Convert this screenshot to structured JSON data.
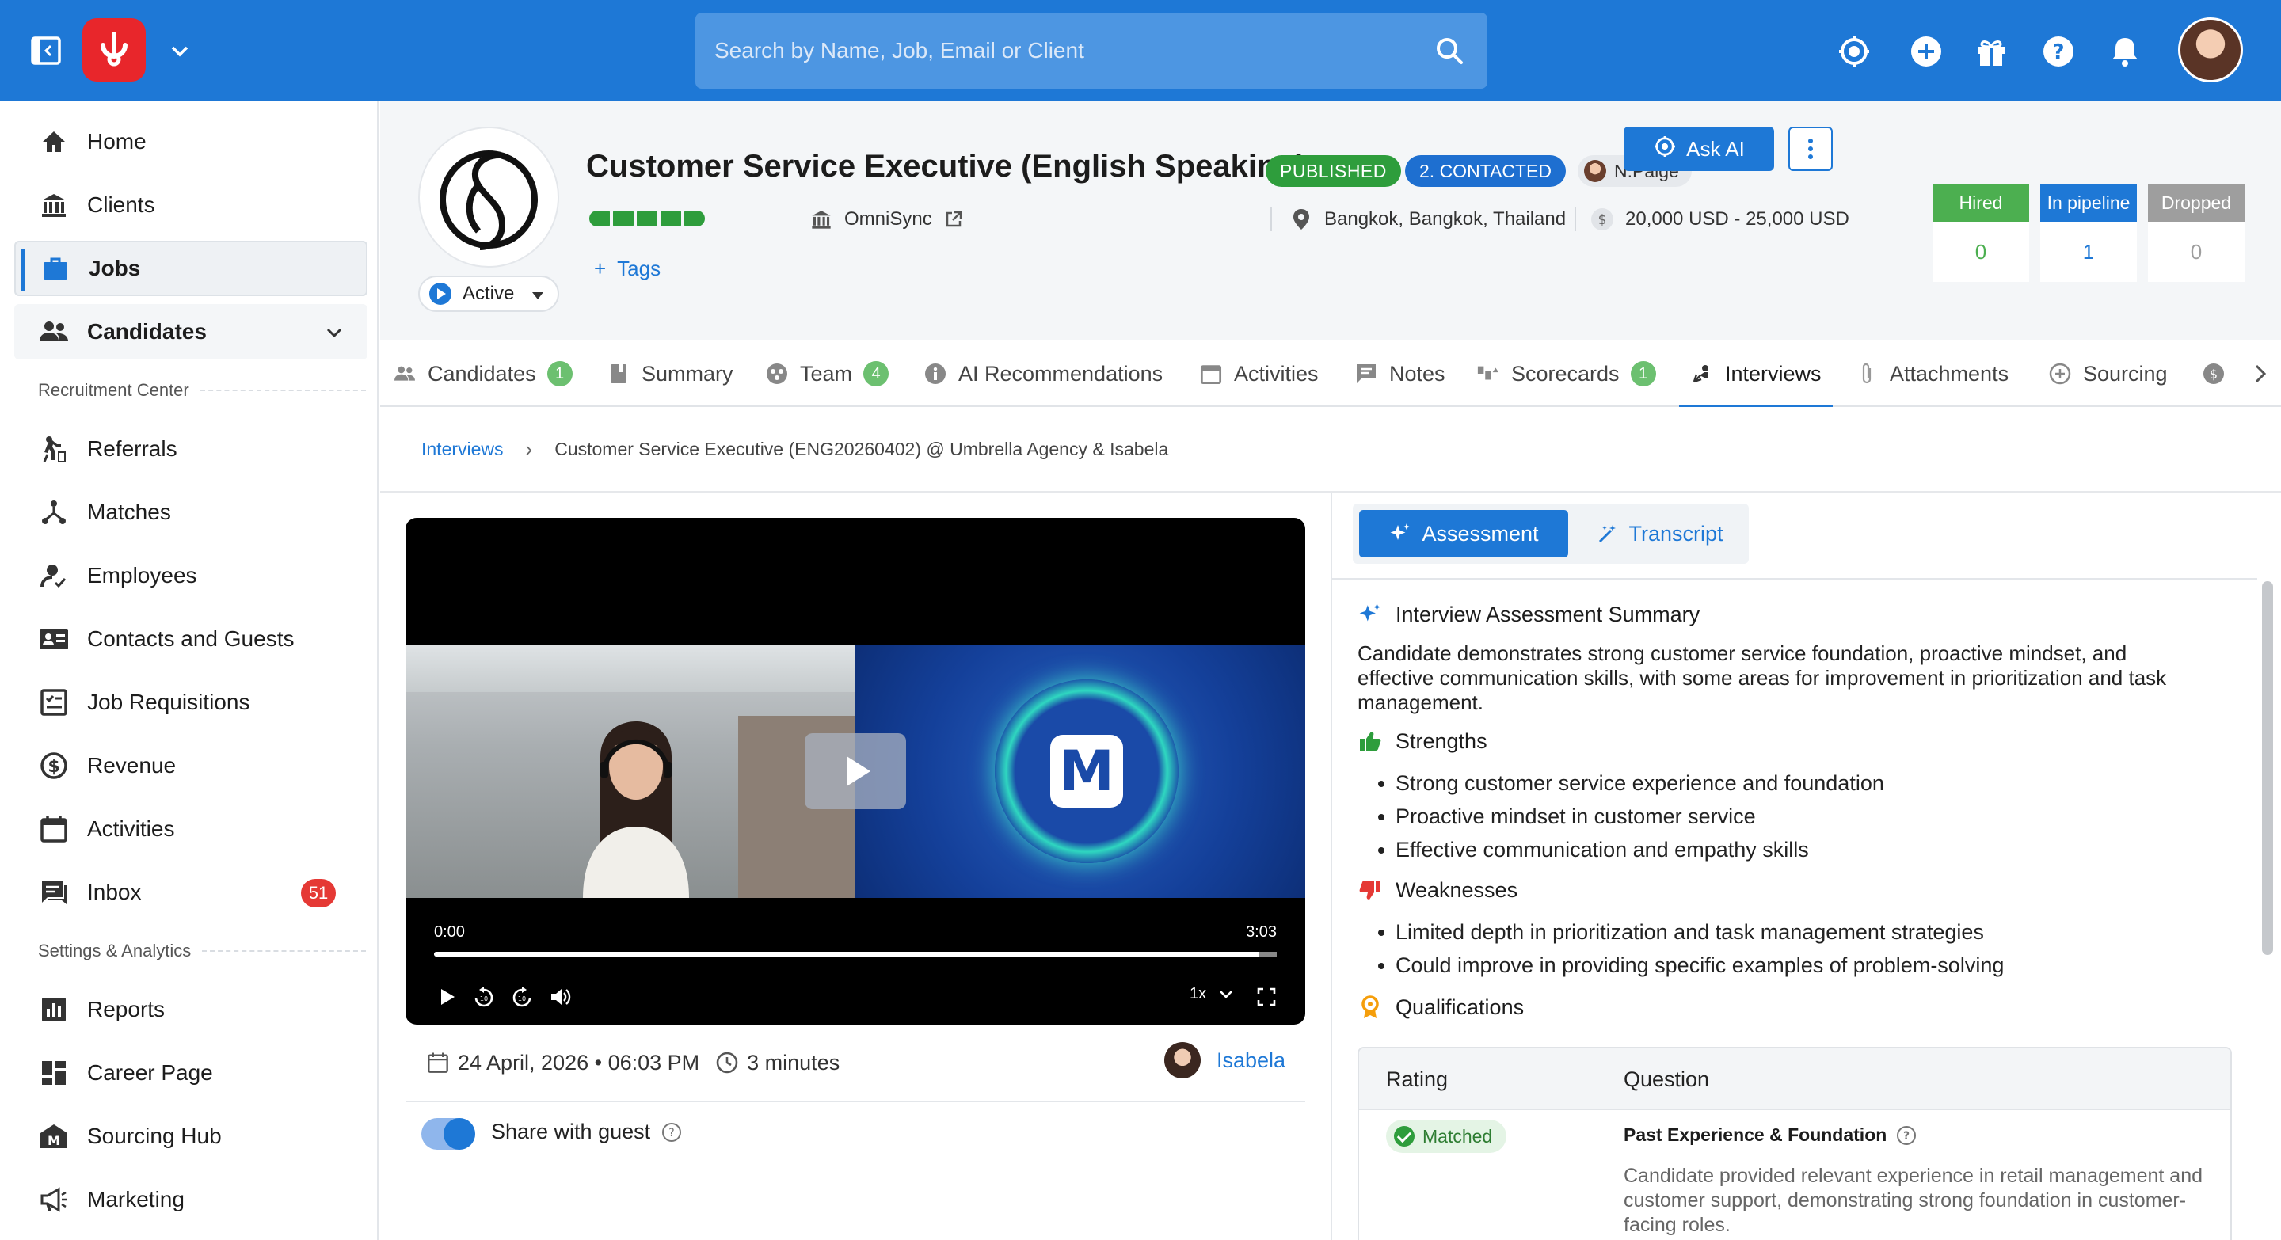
{
  "topbar": {
    "search_placeholder": "Search by Name, Job, Email or Client",
    "icons": [
      "sidebar-toggle-icon",
      "brand-logo",
      "chevron-down-icon",
      "search-icon",
      "ai-sparkle-icon",
      "plus-circle-icon",
      "gift-icon",
      "help-icon",
      "bell-icon",
      "user-avatar"
    ],
    "brand_color": "#1e78d6",
    "logo_color": "#e8262b"
  },
  "sidebar": {
    "items": [
      {
        "label": "Home",
        "icon": "home-icon"
      },
      {
        "label": "Clients",
        "icon": "building-icon"
      },
      {
        "label": "Jobs",
        "icon": "briefcase-icon",
        "active": true
      },
      {
        "label": "Candidates",
        "icon": "people-icon"
      }
    ],
    "section_recruitment": "Recruitment Center",
    "recruitment_items": [
      {
        "label": "Referrals",
        "icon": "referral-icon"
      },
      {
        "label": "Matches",
        "icon": "matches-icon"
      },
      {
        "label": "Employees",
        "icon": "employee-icon"
      },
      {
        "label": "Contacts and Guests",
        "icon": "contacts-icon"
      },
      {
        "label": "Job Requisitions",
        "icon": "requisition-icon"
      },
      {
        "label": "Revenue",
        "icon": "dollar-icon"
      },
      {
        "label": "Activities",
        "icon": "calendar-icon"
      },
      {
        "label": "Inbox",
        "icon": "inbox-icon",
        "badge": "51"
      }
    ],
    "section_settings": "Settings & Analytics",
    "settings_items": [
      {
        "label": "Reports",
        "icon": "reports-icon"
      },
      {
        "label": "Career Page",
        "icon": "career-page-icon"
      },
      {
        "label": "Sourcing Hub",
        "icon": "sourcing-hub-icon"
      },
      {
        "label": "Marketing",
        "icon": "megaphone-icon"
      }
    ]
  },
  "job": {
    "title": "Customer Service Executive (English Speaking)",
    "status_published": "PUBLISHED",
    "stage": "2. CONTACTED",
    "owner": "N.Paige",
    "company": "OmniSync",
    "location": "Bangkok, Bangkok, Thailand",
    "salary": "20,000 USD - 25,000 USD",
    "tags_label": "Tags",
    "status_select": "Active",
    "ask_ai_label": "Ask AI",
    "rating_filled": 5,
    "stats": [
      {
        "label": "Hired",
        "value": "0",
        "color": "#4caf50"
      },
      {
        "label": "In pipeline",
        "value": "1",
        "color": "#1e78d6"
      },
      {
        "label": "Dropped",
        "value": "0",
        "color": "#9e9e9e"
      }
    ]
  },
  "tabs": [
    {
      "label": "Candidates",
      "count": "1",
      "icon": "people-icon"
    },
    {
      "label": "Summary",
      "icon": "summary-icon"
    },
    {
      "label": "Team",
      "count": "4",
      "icon": "team-icon"
    },
    {
      "label": "AI Recommendations",
      "icon": "info-icon"
    },
    {
      "label": "Activities",
      "icon": "calendar-icon"
    },
    {
      "label": "Notes",
      "icon": "notes-icon"
    },
    {
      "label": "Scorecards",
      "count": "1",
      "icon": "scorecard-icon"
    },
    {
      "label": "Interviews",
      "icon": "interview-icon",
      "active": true
    },
    {
      "label": "Attachments",
      "icon": "paperclip-icon"
    },
    {
      "label": "Sourcing",
      "icon": "plus-circle-icon"
    }
  ],
  "breadcrumb": {
    "parent": "Interviews",
    "current": "Customer Service Executive (ENG20260402) @ Umbrella Agency & Isabela"
  },
  "video": {
    "time_start": "0:00",
    "time_end": "3:03",
    "speed": "1x",
    "progress": 0.98
  },
  "interview": {
    "date": "24 April, 2026 • 06:03 PM",
    "duration": "3 minutes",
    "candidate": "Isabela",
    "share_label": "Share with guest",
    "share_on": true
  },
  "assessment": {
    "tab_assessment": "Assessment",
    "tab_transcript": "Transcript",
    "summary_title": "Interview Assessment Summary",
    "summary_text": "Candidate demonstrates strong customer service foundation, proactive mindset, and effective communication skills, with some areas for improvement in prioritization and task management.",
    "strengths_title": "Strengths",
    "strengths": [
      "Strong customer service experience and foundation",
      "Proactive mindset in customer service",
      "Effective communication and empathy skills"
    ],
    "weaknesses_title": "Weaknesses",
    "weaknesses": [
      "Limited depth in prioritization and task management strategies",
      "Could improve in providing specific examples of problem-solving"
    ],
    "qualifications_title": "Qualifications",
    "table": {
      "col_rating": "Rating",
      "col_question": "Question",
      "rows": [
        {
          "rating": "Matched",
          "question": "Past Experience & Foundation",
          "answer": "Candidate provided relevant experience in retail management and customer support, demonstrating strong foundation in customer-facing roles."
        }
      ]
    }
  }
}
